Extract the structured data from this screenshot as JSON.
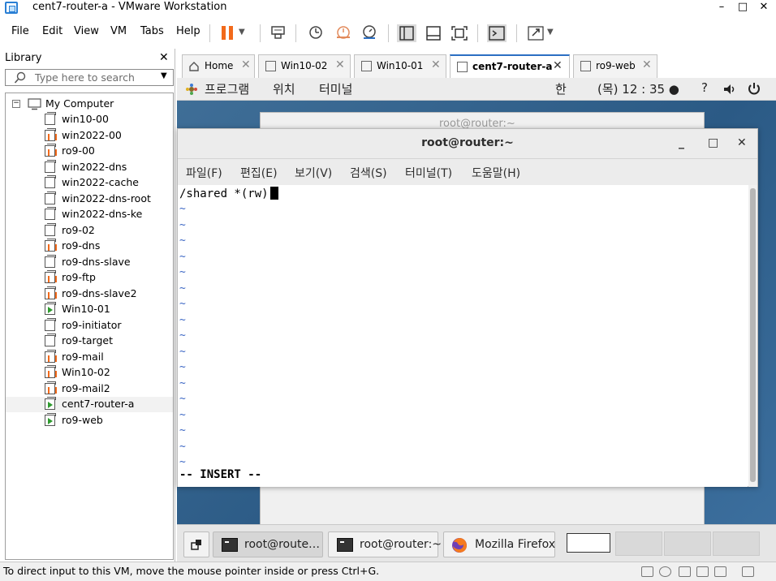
{
  "window": {
    "title": "cent7-router-a - VMware Workstation",
    "controls": {
      "minimize": "–",
      "maximize": "□",
      "close": "✕"
    }
  },
  "menubar": {
    "items": [
      "File",
      "Edit",
      "View",
      "VM",
      "Tabs",
      "Help"
    ],
    "icons": [
      "pause-icon",
      "dropdown-icon",
      "send-ctrl-alt-del-icon",
      "snapshot-icon",
      "revert-snapshot-icon",
      "snapshot-manager-icon",
      "library-view-icon",
      "thumbnail-view-icon",
      "fullscreen-icon",
      "console-icon",
      "stretch-icon"
    ]
  },
  "library": {
    "title": "Library",
    "close": "✕",
    "search_placeholder": "Type here to search",
    "root": "My Computer",
    "vms": [
      {
        "name": "win10-00",
        "state": "off"
      },
      {
        "name": "win2022-00",
        "state": "paused"
      },
      {
        "name": "ro9-00",
        "state": "paused"
      },
      {
        "name": "win2022-dns",
        "state": "off"
      },
      {
        "name": "win2022-cache",
        "state": "off"
      },
      {
        "name": "win2022-dns-root",
        "state": "off"
      },
      {
        "name": "win2022-dns-ke",
        "state": "off"
      },
      {
        "name": "ro9-02",
        "state": "off"
      },
      {
        "name": "ro9-dns",
        "state": "paused"
      },
      {
        "name": "ro9-dns-slave",
        "state": "off"
      },
      {
        "name": "ro9-ftp",
        "state": "paused"
      },
      {
        "name": "ro9-dns-slave2",
        "state": "paused"
      },
      {
        "name": "Win10-01",
        "state": "running"
      },
      {
        "name": "ro9-initiator",
        "state": "off"
      },
      {
        "name": "ro9-target",
        "state": "off"
      },
      {
        "name": "ro9-mail",
        "state": "paused"
      },
      {
        "name": "Win10-02",
        "state": "paused"
      },
      {
        "name": "ro9-mail2",
        "state": "paused"
      },
      {
        "name": "cent7-router-a",
        "state": "running"
      },
      {
        "name": "ro9-web",
        "state": "running"
      }
    ]
  },
  "tabs": [
    {
      "label": "Home",
      "close": "✕"
    },
    {
      "label": "Win10-02",
      "close": "✕"
    },
    {
      "label": "Win10-01",
      "close": "✕"
    },
    {
      "label": "cent7-router-a",
      "close": "✕",
      "active": true
    },
    {
      "label": "ro9-web",
      "close": "✕"
    }
  ],
  "guest": {
    "top_panel": {
      "apps": "프로그램",
      "places": "위치",
      "terminal": "터미널",
      "input_method": "한",
      "clock": "(목) 12 : 35 ●",
      "help": "?"
    },
    "background_window_title": "root@router:~",
    "terminal": {
      "title": "root@router:~",
      "menu": [
        "파일(F)",
        "편집(E)",
        "보기(V)",
        "검색(S)",
        "터미널(T)",
        "도움말(H)"
      ],
      "first_line": "/shared *(rw)",
      "tilde": "~",
      "mode": "-- INSERT --"
    },
    "taskbar": [
      {
        "label": "root@route…",
        "active": true
      },
      {
        "label": "root@router:~",
        "active": false
      },
      {
        "label": "Mozilla Firefox",
        "active": false
      }
    ]
  },
  "statusbar": {
    "text": "To direct input to this VM, move the mouse pointer inside or press Ctrl+G."
  }
}
